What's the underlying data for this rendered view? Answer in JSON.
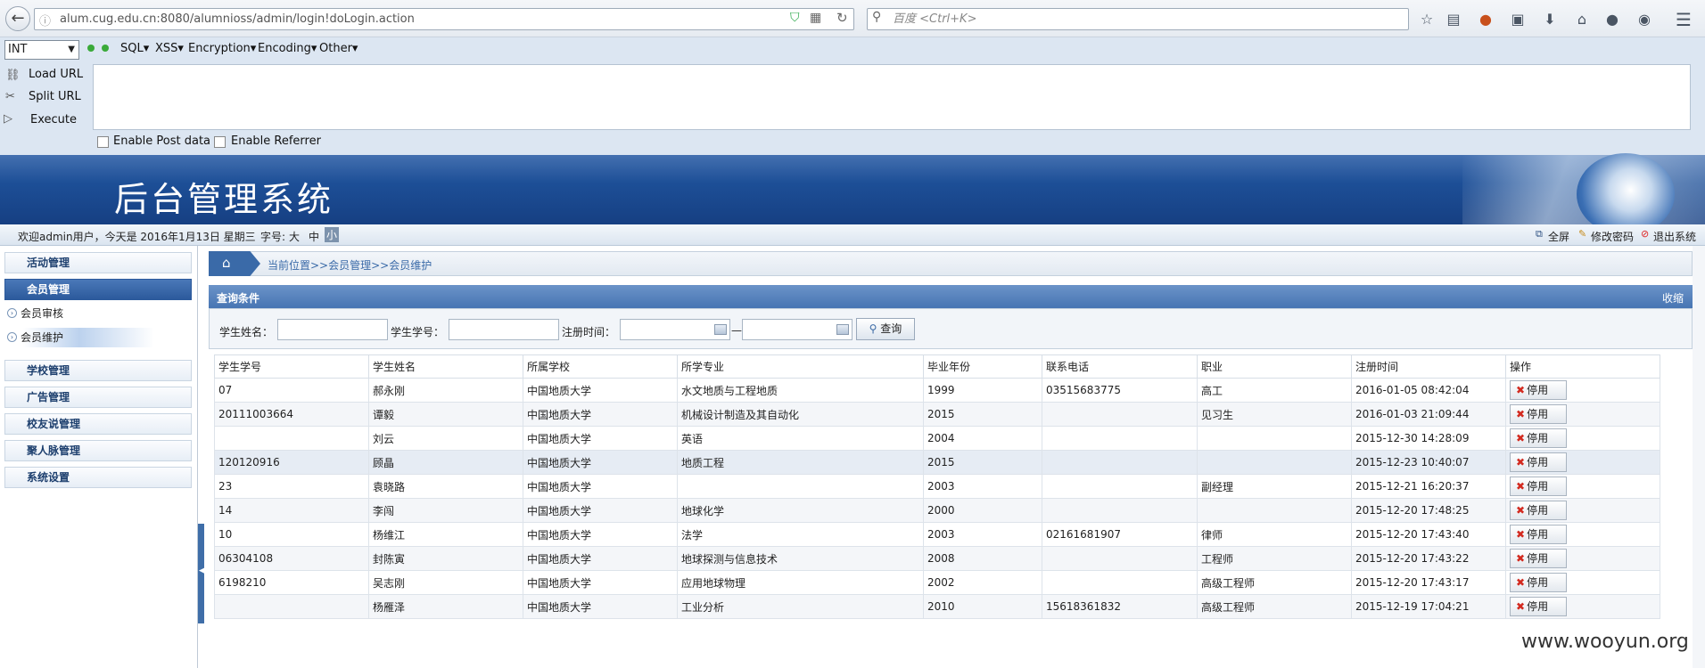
{
  "browser": {
    "url": "alum.cug.edu.cn:8080/alumnioss/admin/login!doLogin.action",
    "search_placeholder": "百度 <Ctrl+K>"
  },
  "hackbar": {
    "type_select": "INT",
    "menus": [
      "SQL▾",
      "XSS▾",
      "Encryption▾",
      "Encoding▾",
      "Other▾"
    ],
    "load_url": "Load URL",
    "split_url": "Split URL",
    "execute": "Execute",
    "enable_post": "Enable Post data",
    "enable_referrer": "Enable Referrer"
  },
  "banner": {
    "title": "后台管理系统"
  },
  "infobar": {
    "welcome": "欢迎admin用户，今天是 2016年1月13日 星期三",
    "fontsize_label": "字号:",
    "font_large": "大",
    "font_medium": "中",
    "font_small": "小",
    "fullscreen": "全屏",
    "change_password": "修改密码",
    "logout": "退出系统"
  },
  "sidebar": {
    "items": [
      {
        "label": "活动管理"
      },
      {
        "label": "会员管理"
      },
      {
        "label": "会员审核"
      },
      {
        "label": "会员维护"
      },
      {
        "label": "学校管理"
      },
      {
        "label": "广告管理"
      },
      {
        "label": "校友说管理"
      },
      {
        "label": "聚人脉管理"
      },
      {
        "label": "系统设置"
      }
    ]
  },
  "breadcrumb": {
    "text": "当前位置>>会员管理>>会员维护"
  },
  "query": {
    "title": "查询条件",
    "collapse": "收缩",
    "name_label": "学生姓名：",
    "id_label": "学生学号：",
    "date_label": "注册时间：",
    "dash": "—",
    "search_button": "查询"
  },
  "table": {
    "headers": [
      "学生学号",
      "学生姓名",
      "所属学校",
      "所学专业",
      "毕业年份",
      "联系电话",
      "职业",
      "注册时间",
      "操作"
    ],
    "stop_label": "停用",
    "rows": [
      [
        "07",
        "郝永刚",
        "中国地质大学",
        "水文地质与工程地质",
        "1999",
        "03515683775",
        "高工",
        "2016-01-05 08:42:04"
      ],
      [
        "20111003664",
        "谭毅",
        "中国地质大学",
        "机械设计制造及其自动化",
        "2015",
        "",
        "见习生",
        "2016-01-03 21:09:44"
      ],
      [
        "",
        "刘云",
        "中国地质大学",
        "英语",
        "2004",
        "",
        "",
        "2015-12-30 14:28:09"
      ],
      [
        "120120916",
        "顾晶",
        "中国地质大学",
        "地质工程",
        "2015",
        "",
        "",
        "2015-12-23 10:40:07"
      ],
      [
        "23",
        "袁晓路",
        "中国地质大学",
        "",
        "2003",
        "",
        "副经理",
        "2015-12-21 16:20:37"
      ],
      [
        "14",
        "李闯",
        "中国地质大学",
        "地球化学",
        "2000",
        "",
        "",
        "2015-12-20 17:48:25"
      ],
      [
        "10",
        "杨维江",
        "中国地质大学",
        "法学",
        "2003",
        "02161681907",
        "律师",
        "2015-12-20 17:43:40"
      ],
      [
        "06304108",
        "封陈寅",
        "中国地质大学",
        "地球探测与信息技术",
        "2008",
        "",
        "工程师",
        "2015-12-20 17:43:22"
      ],
      [
        "6198210",
        "吴志刚",
        "中国地质大学",
        "应用地球物理",
        "2002",
        "",
        "高级工程师",
        "2015-12-20 17:43:17"
      ],
      [
        "",
        "杨雁泽",
        "中国地质大学",
        "工业分析",
        "2010",
        "15618361832",
        "高级工程师",
        "2015-12-19 17:04:21"
      ]
    ]
  },
  "watermark": "www.wooyun.org"
}
